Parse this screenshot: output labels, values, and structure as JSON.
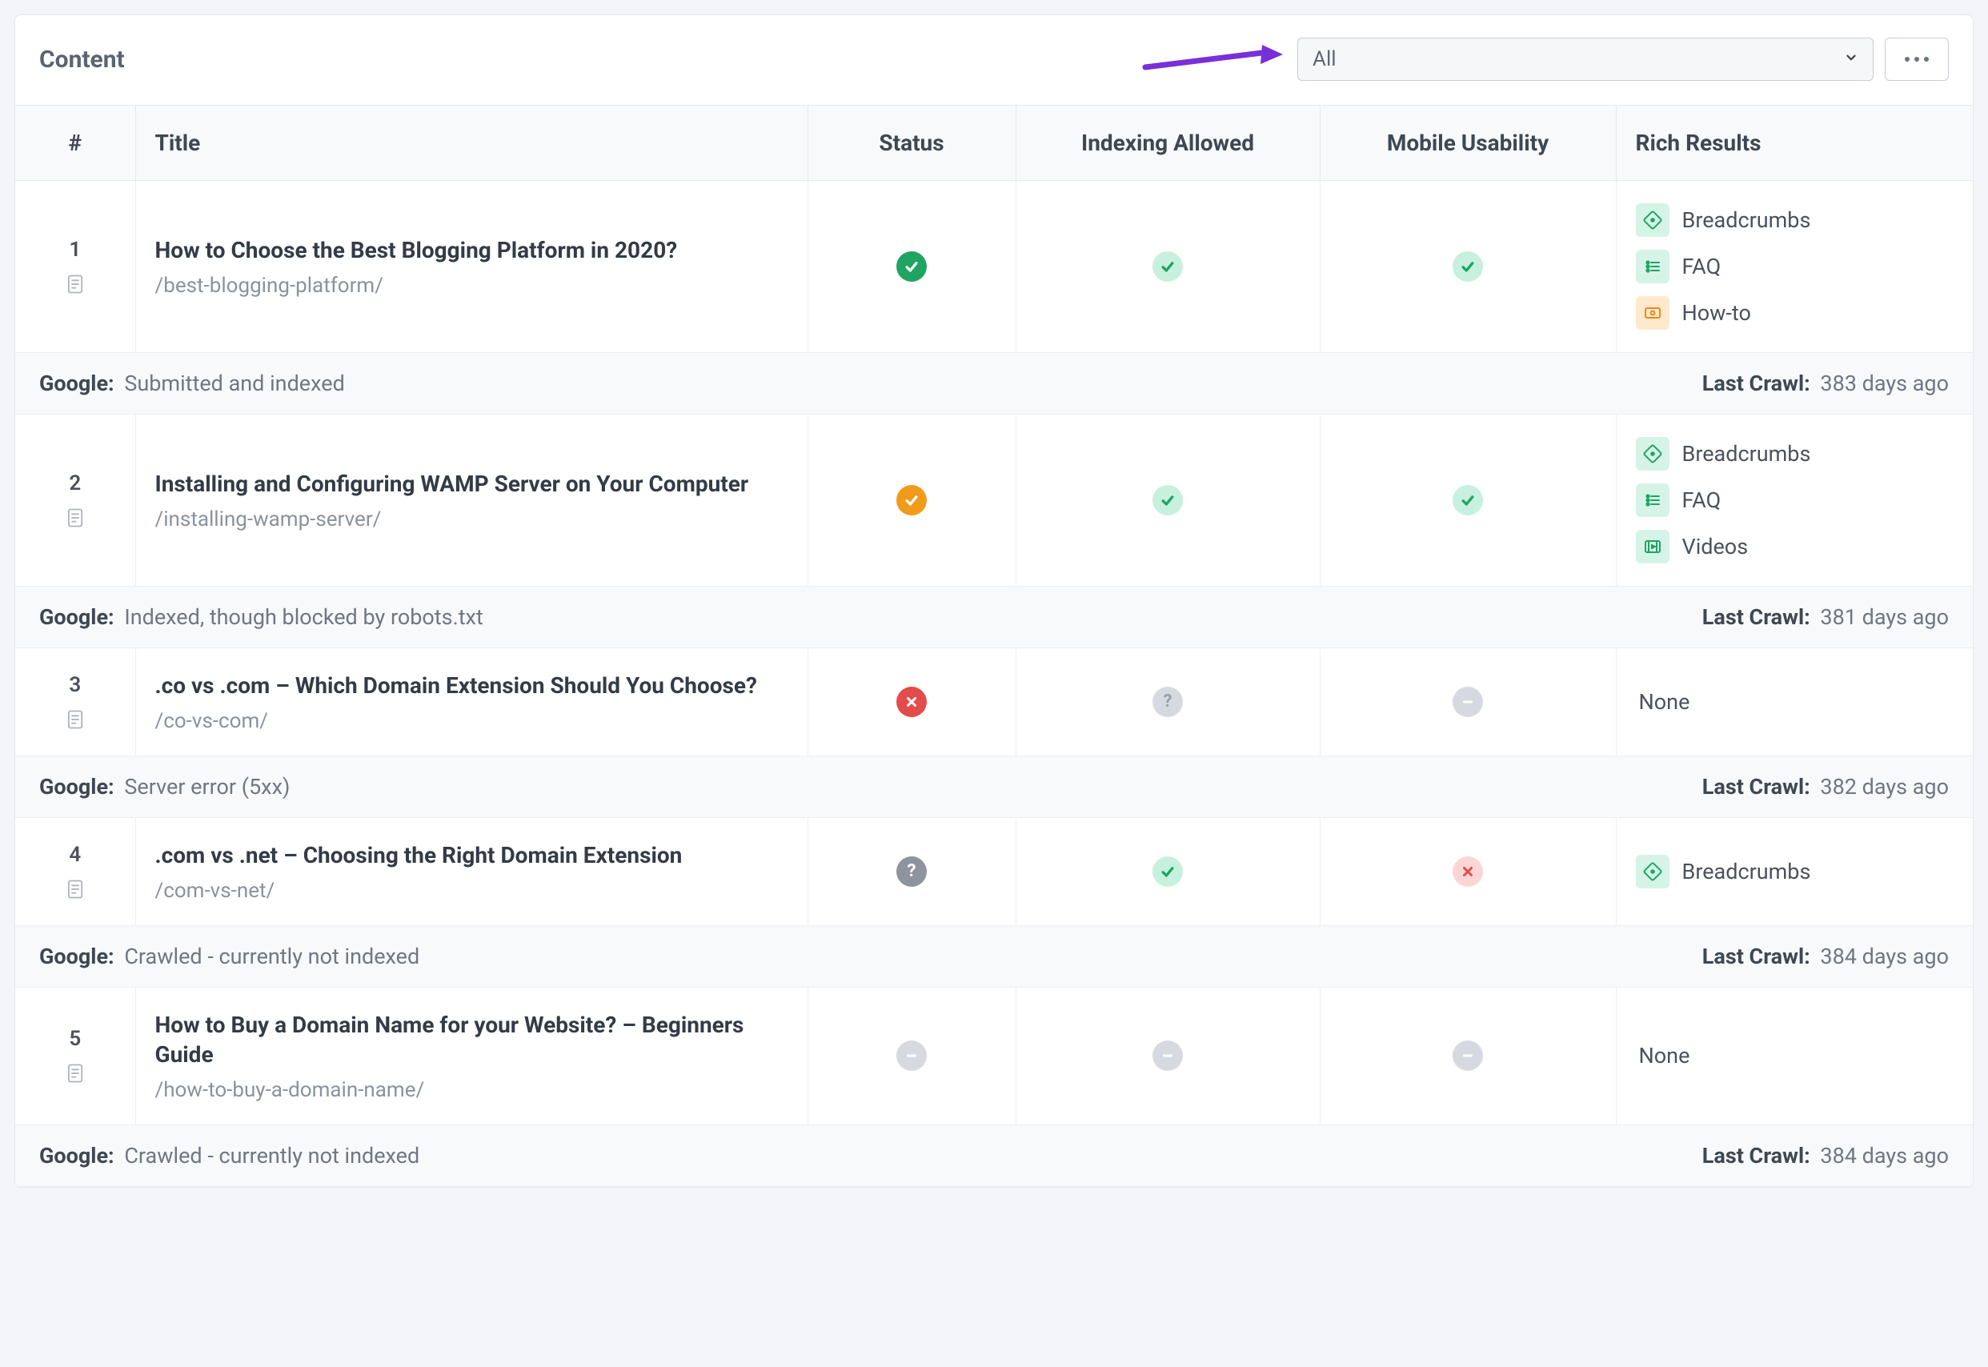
{
  "header": {
    "title": "Content",
    "filter_value": "All"
  },
  "columns": {
    "num": "#",
    "title": "Title",
    "status": "Status",
    "indexing": "Indexing Allowed",
    "mobile": "Mobile Usability",
    "rich": "Rich Results"
  },
  "labels": {
    "google": "Google:",
    "last_crawl": "Last Crawl:",
    "none": "None"
  },
  "rich_types": {
    "breadcrumbs": "Breadcrumbs",
    "faq": "FAQ",
    "howto": "How-to",
    "videos": "Videos"
  },
  "rows": [
    {
      "num": "1",
      "title": "How to Choose the Best Blogging Platform in 2020?",
      "path": "/best-blogging-platform/",
      "status": "green-solid",
      "indexing": "green-light",
      "mobile": "green-light",
      "rich": [
        "breadcrumbs",
        "faq",
        "howto"
      ],
      "google_status": "Submitted and indexed",
      "last_crawl": "383 days ago"
    },
    {
      "num": "2",
      "title": "Installing and Configuring WAMP Server on Your Computer",
      "path": "/installing-wamp-server/",
      "status": "orange-solid",
      "indexing": "green-light",
      "mobile": "green-light",
      "rich": [
        "breadcrumbs",
        "faq",
        "videos"
      ],
      "google_status": "Indexed, though blocked by robots.txt",
      "last_crawl": "381 days ago"
    },
    {
      "num": "3",
      "title": ".co vs .com – Which Domain Extension Should You Choose?",
      "path": "/co-vs-com/",
      "status": "red-solid",
      "indexing": "gray-light-question",
      "mobile": "gray-light-dash",
      "rich": [],
      "google_status": "Server error (5xx)",
      "last_crawl": "382 days ago"
    },
    {
      "num": "4",
      "title": ".com vs .net – Choosing the Right Domain Extension",
      "path": "/com-vs-net/",
      "status": "gray-solid-question",
      "indexing": "green-light",
      "mobile": "red-light",
      "rich": [
        "breadcrumbs"
      ],
      "google_status": "Crawled - currently not indexed",
      "last_crawl": "384 days ago"
    },
    {
      "num": "5",
      "title": "How to Buy a Domain Name for your Website? – Beginners Guide",
      "path": "/how-to-buy-a-domain-name/",
      "status": "gray-light-dash",
      "indexing": "gray-light-dash",
      "mobile": "gray-light-dash",
      "rich": [],
      "google_status": "Crawled - currently not indexed",
      "last_crawl": "384 days ago"
    }
  ]
}
